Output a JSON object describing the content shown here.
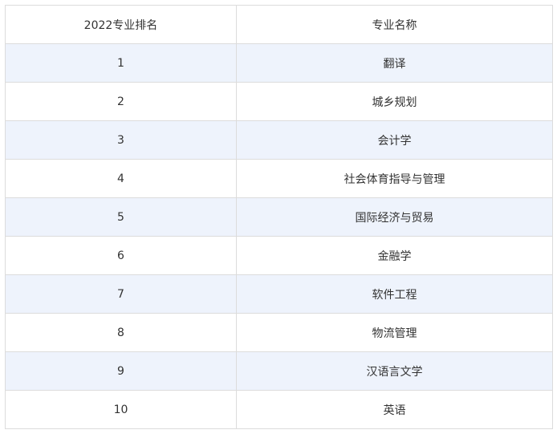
{
  "table": {
    "headers": [
      "2022专业排名",
      "专业名称"
    ],
    "rows": [
      [
        "1",
        "翻译"
      ],
      [
        "2",
        "城乡规划"
      ],
      [
        "3",
        "会计学"
      ],
      [
        "4",
        "社会体育指导与管理"
      ],
      [
        "5",
        "国际经济与贸易"
      ],
      [
        "6",
        "金融学"
      ],
      [
        "7",
        "软件工程"
      ],
      [
        "8",
        "物流管理"
      ],
      [
        "9",
        "汉语言文学"
      ],
      [
        "10",
        "英语"
      ]
    ]
  },
  "colors": {
    "stripe": "#eef3fc",
    "border": "#dcdcdc",
    "text": "#333333"
  }
}
